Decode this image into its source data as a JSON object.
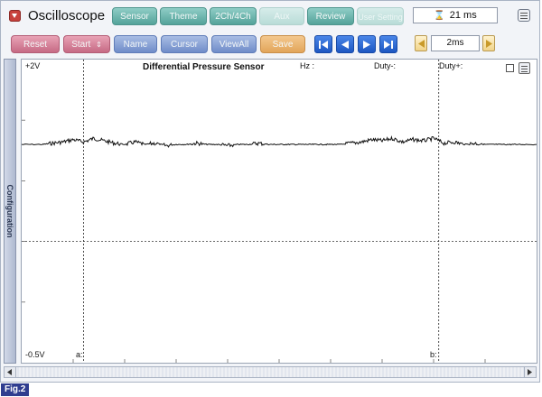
{
  "app": {
    "title": "Oscilloscope"
  },
  "toolbar": {
    "row1": [
      {
        "id": "sensor",
        "label": "Sensor",
        "enabled": true
      },
      {
        "id": "theme",
        "label": "Theme",
        "enabled": true
      },
      {
        "id": "channels",
        "label": "2Ch/4Ch",
        "enabled": true
      },
      {
        "id": "aux",
        "label": "Aux",
        "enabled": false
      },
      {
        "id": "review",
        "label": "Review",
        "enabled": true
      },
      {
        "id": "user-setting",
        "label": "User Setting",
        "enabled": false
      }
    ],
    "row2": [
      {
        "id": "reset",
        "label": "Reset"
      },
      {
        "id": "start",
        "label": "Start"
      },
      {
        "id": "name",
        "label": "Name"
      },
      {
        "id": "cursor",
        "label": "Cursor"
      },
      {
        "id": "viewall",
        "label": "ViewAll"
      },
      {
        "id": "save",
        "label": "Save"
      }
    ],
    "sample_time": "21 ms",
    "timebase": "2ms",
    "nav_icons": [
      "first-icon",
      "prev-icon",
      "play-icon",
      "last-icon"
    ]
  },
  "side_tab": {
    "label": "Configuration"
  },
  "plot": {
    "title": "Differential Pressure Sensor",
    "y_top_label": "+2V",
    "y_bottom_label": "-0.5V",
    "hz_label": "Hz :",
    "duty_minus_label": "Duty-:",
    "duty_plus_label": "Duty+:",
    "cursor_a_label": "a:",
    "cursor_b_label": "b:"
  },
  "chart_data": {
    "type": "line",
    "title": "Differential Pressure Sensor",
    "xlabel": "",
    "ylabel": "",
    "ylim": [
      -0.5,
      2
    ],
    "xlim": [
      0,
      1
    ],
    "grid": true,
    "series": [
      {
        "signal": "noisy-flat-line",
        "x": [
          0.0,
          0.04,
          0.06,
          0.08,
          0.1,
          0.12,
          0.14,
          0.16,
          0.18,
          0.2,
          0.22,
          0.24,
          0.26,
          0.28,
          0.3,
          0.32,
          0.34,
          0.36,
          0.38,
          0.4,
          0.42,
          0.44,
          0.46,
          0.48,
          0.5,
          0.52,
          0.54,
          0.56,
          0.58,
          0.6,
          0.62,
          0.64,
          0.66,
          0.68,
          0.7,
          0.72,
          0.74,
          0.76,
          0.78,
          0.8,
          0.82,
          0.84,
          0.86,
          0.88,
          0.9,
          0.92,
          0.94,
          0.96,
          1.0
        ],
        "y": [
          1.3,
          1.3,
          1.31,
          1.32,
          1.34,
          1.32,
          1.35,
          1.33,
          1.31,
          1.3,
          1.32,
          1.3,
          1.31,
          1.29,
          1.3,
          1.3,
          1.31,
          1.3,
          1.3,
          1.29,
          1.3,
          1.3,
          1.31,
          1.3,
          1.3,
          1.3,
          1.3,
          1.3,
          1.3,
          1.3,
          1.3,
          1.31,
          1.32,
          1.34,
          1.33,
          1.35,
          1.32,
          1.34,
          1.33,
          1.35,
          1.31,
          1.32,
          1.3,
          1.31,
          1.3,
          1.3,
          1.3,
          1.3,
          1.3
        ]
      }
    ],
    "cursors": [
      {
        "name": "a",
        "x": 0.12
      },
      {
        "name": "b",
        "x": 0.81
      }
    ],
    "hline_level": 0.5
  },
  "colors": {
    "teal_button": "#54a39a",
    "pink_button": "#c66a84",
    "blue_button": "#6f8cc9",
    "save_button": "#e2a55a",
    "nav_button": "#1d57c2",
    "figure_label_bg": "#2f3d8f"
  },
  "caption": {
    "label": "Fig.2"
  }
}
